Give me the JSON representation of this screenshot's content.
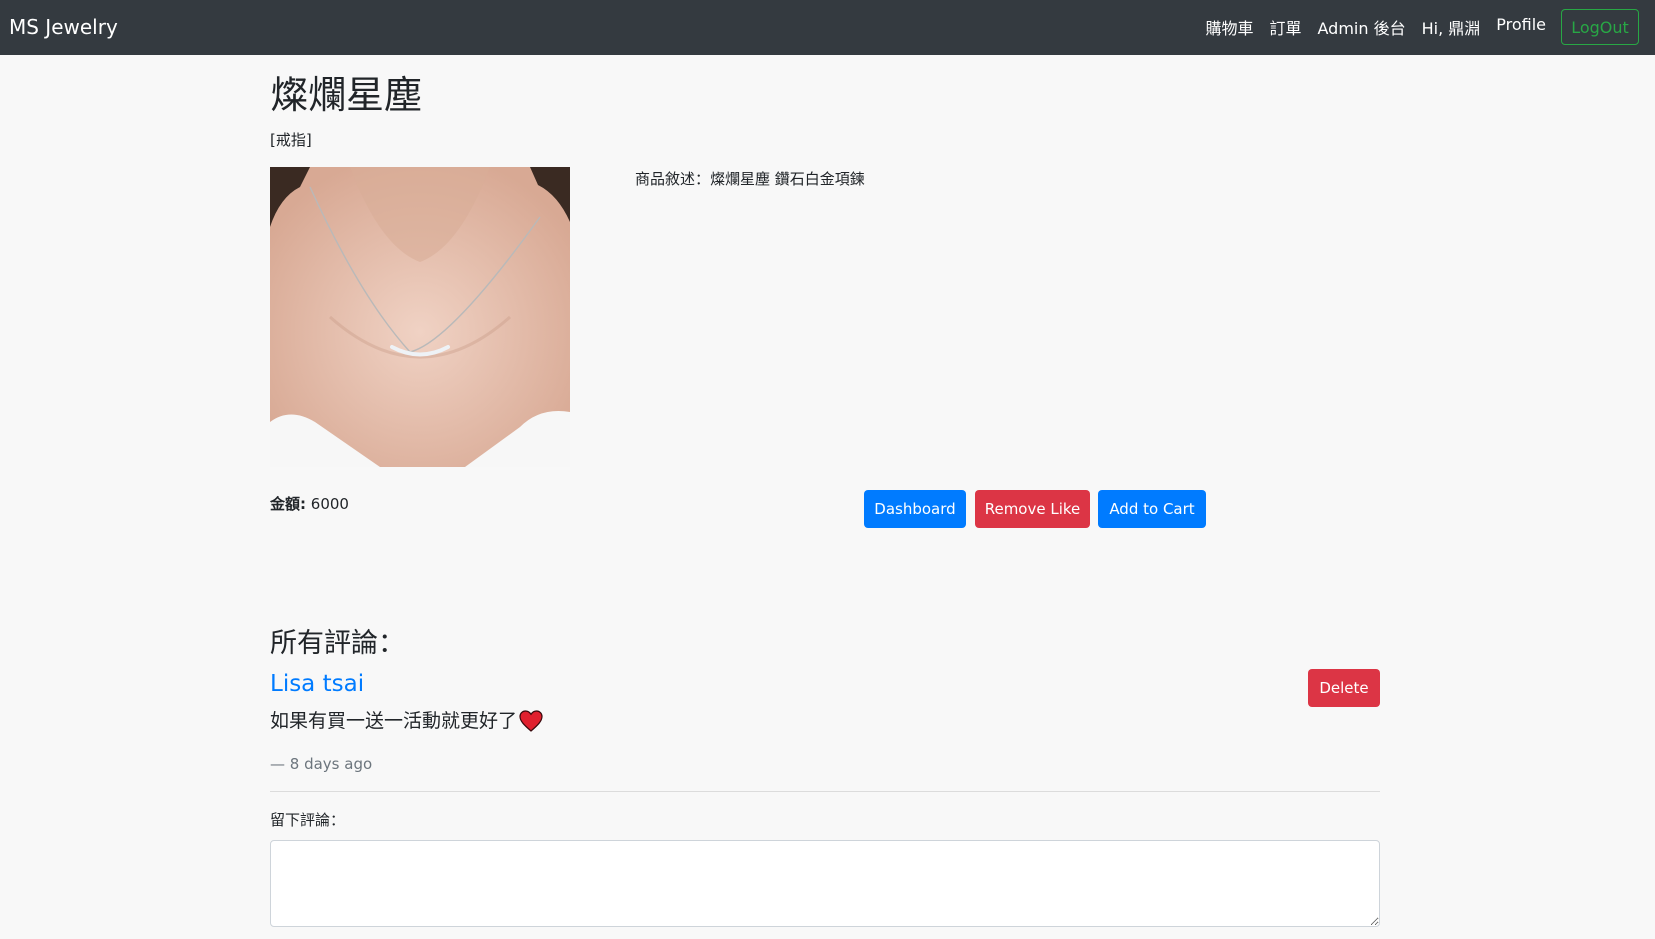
{
  "navbar": {
    "brand": "MS Jewelry",
    "links": [
      "購物車",
      "訂單",
      "Admin 後台",
      "Hi, 鼎淵",
      "Profile"
    ],
    "logout_label": "LogOut",
    "background_color": "#343a40",
    "logout_color": "#28a745"
  },
  "product": {
    "title": "燦爛星塵",
    "category": "[戒指]",
    "description": "商品敘述：燦爛星塵 鑽石白金項鍊",
    "price_label": "金額:",
    "price_value": "6000",
    "image_icon": "necklace-photo"
  },
  "actions": {
    "dashboard_label": "Dashboard",
    "remove_like_label": "Remove Like",
    "add_to_cart_label": "Add to Cart",
    "primary_color": "#007bff",
    "danger_color": "#dc3545"
  },
  "comments": {
    "heading": "所有評論：",
    "items": [
      {
        "author": "Lisa tsai",
        "text": "如果有買一送一活動就更好了",
        "time": "— 8 days ago",
        "delete_label": "Delete",
        "emoji_icon": "heart-icon"
      }
    ]
  },
  "new_comment": {
    "label": "留下評論：",
    "value": ""
  }
}
